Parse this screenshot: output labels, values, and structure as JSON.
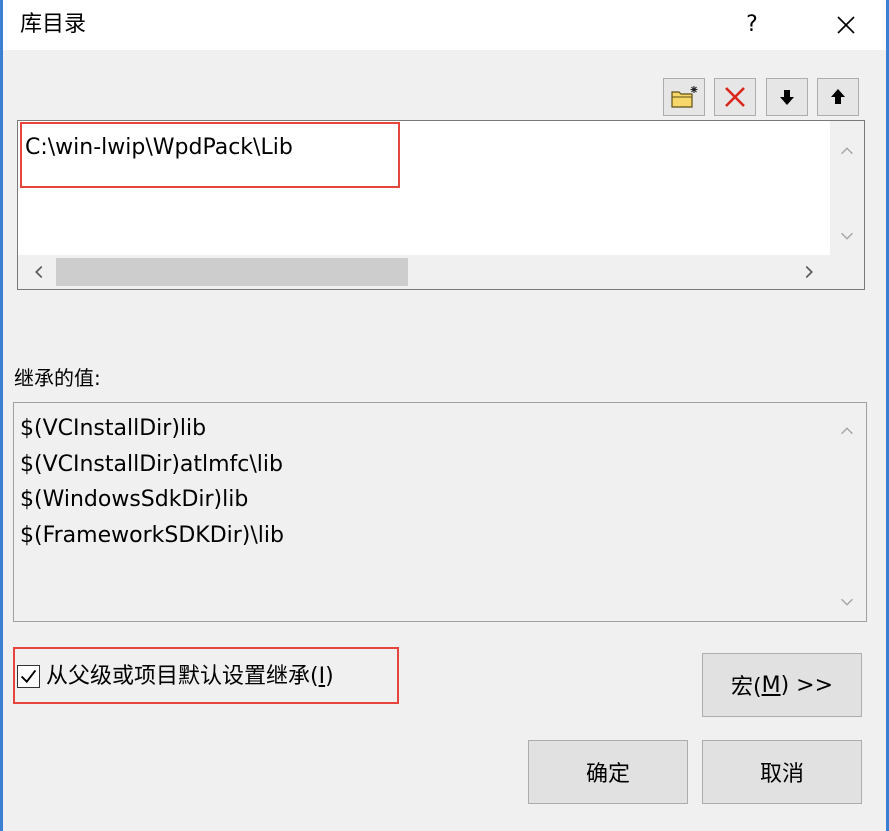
{
  "window": {
    "title": "库目录",
    "help_label": "?",
    "close_icon": "close-icon"
  },
  "colors": {
    "window_border": "#3b7fd0",
    "dialog_background": "#f0f0f0",
    "annotation_red": "#e5453c",
    "delete_red": "#d9261c",
    "folder_yellow": "#f7d76a"
  },
  "toolbar": {
    "buttons": [
      {
        "icon": "new-folder-icon"
      },
      {
        "icon": "delete-icon"
      },
      {
        "icon": "move-down-icon"
      },
      {
        "icon": "move-up-icon"
      }
    ]
  },
  "edit_list": {
    "items": [
      "C:\\win-lwip\\WpdPack\\Lib"
    ],
    "horizontal_scroll": {
      "position": 0,
      "thumb_fraction": 0.48
    }
  },
  "inherited": {
    "label": "继承的值:",
    "items": [
      "$(VCInstallDir)lib",
      "$(VCInstallDir)atlmfc\\lib",
      "$(WindowsSdkDir)lib",
      "$(FrameworkSDKDir)\\lib"
    ]
  },
  "inherit_checkbox": {
    "checked": true,
    "label_before": "从父级或项目默认设置继承(",
    "accel_key": "I",
    "label_after": ")"
  },
  "buttons": {
    "macros": {
      "label_before": "宏(",
      "accel_key": "M",
      "label_after": ") >>"
    },
    "ok": "确定",
    "cancel": "取消"
  }
}
